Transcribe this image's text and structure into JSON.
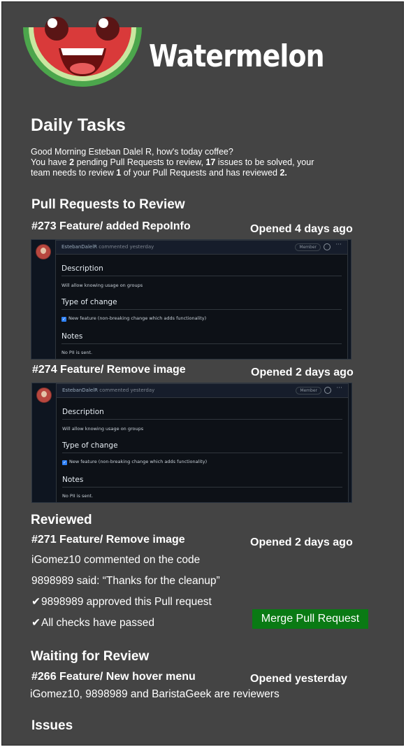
{
  "app": {
    "name": "Watermelon"
  },
  "daily_tasks": {
    "title": "Daily Tasks",
    "intro": {
      "line1": "Good Morning Esteban Dalel R, how's today coffee?",
      "line2_a": "You have ",
      "pending_prs": "2",
      "line2_b": " pending Pull Requests to review, ",
      "issues_count": "17",
      "line2_c": " issues to be solved, your",
      "line3_a": "team needs to review ",
      "team_to_review": "1",
      "line3_b": " of your Pull Requests and has reviewed ",
      "team_reviewed": "2."
    }
  },
  "pull_requests_to_review": {
    "title": "Pull Requests to Review",
    "items": [
      {
        "title": "#273 Feature/ added RepoInfo",
        "opened": "Opened 4 days ago",
        "card": {
          "author": "EstebanDalelR",
          "commented": "commented yesterday",
          "badge": "Member",
          "description_heading": "Description",
          "description": "Will allow knowing usage on groups",
          "type_heading": "Type of change",
          "type_value": "New feature (non-breaking change which adds functionality)",
          "notes_heading": "Notes",
          "notes": "No PII is sent."
        }
      },
      {
        "title": "#274 Feature/ Remove image",
        "opened": "Opened 2 days ago",
        "card": {
          "author": "EstebanDalelR",
          "commented": "commented yesterday",
          "badge": "Member",
          "description_heading": "Description",
          "description": "Will allow knowing usage on groups",
          "type_heading": "Type of change",
          "type_value": "New feature (non-breaking change which adds functionality)",
          "notes_heading": "Notes",
          "notes": "No PII is sent."
        }
      }
    ]
  },
  "reviewed": {
    "title": "Reviewed",
    "pr_title": "#271 Feature/ Remove image",
    "opened": "Opened 2 days ago",
    "comment1": "iGomez10 commented on the code",
    "comment2": "9898989 said: “Thanks for the cleanup”",
    "approved": "9898989  approved this Pull request",
    "checks": "All checks have passed",
    "merge_button": "Merge Pull Request",
    "merge_color": "#0a7a14"
  },
  "waiting": {
    "title": "Waiting for Review",
    "pr_title": "#266 Feature/ New hover menu",
    "opened": "Opened yesterday",
    "reviewers": "iGomez10, 9898989 and BaristaGeek are reviewers"
  },
  "issues": {
    "title": "Issues"
  },
  "theme": {
    "background": "#444444",
    "card_background": "#0d1117",
    "link_blue": "#2f81f7"
  }
}
